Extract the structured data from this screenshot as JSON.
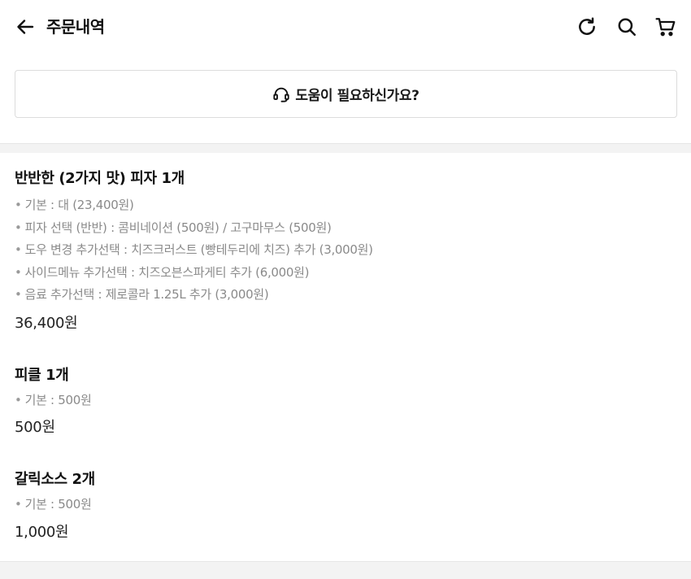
{
  "header": {
    "title": "주문내역",
    "icons": [
      "arrow-left-icon",
      "refresh-icon",
      "search-icon",
      "cart-icon"
    ]
  },
  "help": {
    "label": "도움이 필요하신가요?",
    "icon": "headset-icon"
  },
  "items": [
    {
      "name": "반반한 (2가지 맛) 피자 1개",
      "options": [
        "기본 : 대 (23,400원)",
        "피자 선택 (반반) : 콤비네이션 (500원) / 고구마무스 (500원)",
        "도우 변경 추가선택 : 치즈크러스트 (빵테두리에 치즈) 추가 (3,000원)",
        "사이드메뉴 추가선택 : 치즈오븐스파게티 추가 (6,000원)",
        "음료 추가선택 : 제로콜라 1.25L 추가 (3,000원)"
      ],
      "price": "36,400원"
    },
    {
      "name": "피클 1개",
      "options": [
        "기본 : 500원"
      ],
      "price": "500원"
    },
    {
      "name": "갈릭소스 2개",
      "options": [
        "기본 : 500원"
      ],
      "price": "1,000원"
    }
  ]
}
